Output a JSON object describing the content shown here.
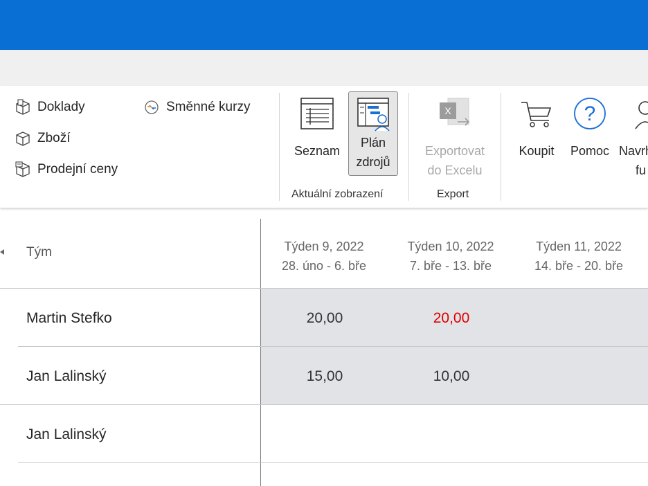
{
  "ribbon": {
    "nav_items": [
      {
        "label": "Doklady",
        "icon": "documents-box-icon"
      },
      {
        "label": "Zboží",
        "icon": "goods-box-icon"
      },
      {
        "label": "Prodejní ceny",
        "icon": "sales-prices-icon"
      },
      {
        "label": "Směnné kurzy",
        "icon": "exchange-rates-icon"
      }
    ],
    "view_group": {
      "label": "Aktuální zobrazení",
      "list_label": "Seznam",
      "plan_label_line1": "Plán",
      "plan_label_line2": "zdrojů"
    },
    "export_group": {
      "label": "Export",
      "excel_line1": "Exportovat",
      "excel_line2": "do Excelu"
    },
    "buy_label": "Koupit",
    "help_label": "Pomoc",
    "suggest_line1": "Navrh",
    "suggest_line2": "fu"
  },
  "table": {
    "team_header": "Tým",
    "weeks": [
      {
        "title": "Týden 9, 2022",
        "range": "28. úno - 6. bře"
      },
      {
        "title": "Týden 10, 2022",
        "range": "7. bře - 13. bře"
      },
      {
        "title": "Týden 11, 2022",
        "range": "14. bře - 20. bře"
      }
    ],
    "rows": [
      {
        "name": "Martin Stefko",
        "w9": "20,00",
        "w10": "20,00",
        "w10_overload": true
      },
      {
        "name": "Jan Lalinský",
        "w9": "15,00",
        "w10": "10,00"
      },
      {
        "name": "Jan Lalinský",
        "w9": "",
        "w10": ""
      }
    ]
  },
  "colors": {
    "topbar": "#0a6fd4",
    "overload": "#e00000",
    "selected_bg": "#e1e3e7"
  }
}
